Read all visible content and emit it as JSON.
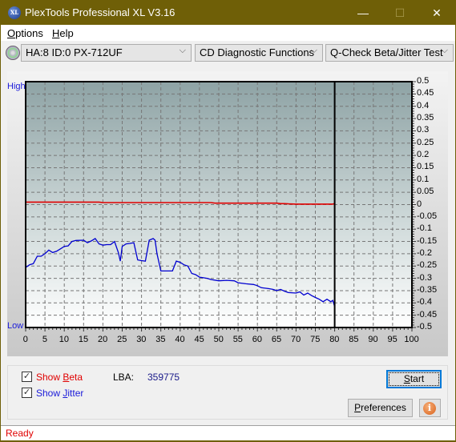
{
  "window": {
    "title": "PlexTools Professional XL V3.16",
    "app_icon": "XL",
    "minimize_icon": "—",
    "maximize_icon": "☐",
    "close_icon": "✕"
  },
  "menu": {
    "items": [
      {
        "label": "Options",
        "accel": "O"
      },
      {
        "label": "Help",
        "accel": "H"
      }
    ]
  },
  "toolbar": {
    "drive_select": "HA:8 ID:0  PX-712UF",
    "function_select": "CD Diagnostic Functions",
    "test_select": "Q-Check Beta/Jitter Test",
    "chevron": "⌵"
  },
  "chart": {
    "high_label": "High",
    "low_label": "Low"
  },
  "chart_data": {
    "type": "line",
    "title": "",
    "xlabel": "",
    "ylabel": "",
    "xlim": [
      0,
      100
    ],
    "ylim": [
      -0.5,
      0.5
    ],
    "x_ticks": [
      0,
      5,
      10,
      15,
      20,
      25,
      30,
      35,
      40,
      45,
      50,
      55,
      60,
      65,
      70,
      75,
      80,
      85,
      90,
      95,
      100
    ],
    "y_ticks": [
      0.5,
      0.45,
      0.4,
      0.35,
      0.3,
      0.25,
      0.2,
      0.15,
      0.1,
      0.05,
      0,
      -0.05,
      -0.1,
      -0.15,
      -0.2,
      -0.25,
      -0.3,
      -0.35,
      -0.4,
      -0.45,
      -0.5
    ],
    "y_tick_labels": [
      "0.5",
      "0.45",
      "0.4",
      "0.35",
      "0.3",
      "0.25",
      "0.2",
      "0.15",
      "0.1",
      "0.05",
      "0",
      "-0.05",
      "-0.1",
      "-0.15",
      "-0.2",
      "-0.25",
      "-0.3",
      "-0.35",
      "-0.4",
      "-0.45",
      "-0.5"
    ],
    "grid": true,
    "end_marker_x": 80,
    "series": [
      {
        "name": "Beta",
        "color": "#e00000",
        "x": [
          0,
          2,
          19,
          20,
          48,
          49,
          65,
          66,
          67,
          68,
          70,
          75,
          79.5,
          80
        ],
        "y": [
          0.01,
          0.01,
          0.01,
          0.008,
          0.008,
          0.006,
          0.006,
          0.004,
          0.004,
          0.003,
          0.002,
          0.002,
          0.002,
          0.004
        ]
      },
      {
        "name": "Jitter",
        "color": "#0000d0",
        "x": [
          0,
          1,
          2,
          3,
          4,
          5,
          6,
          7,
          8,
          9,
          10,
          11,
          12,
          13,
          15,
          16,
          17,
          18,
          19,
          20,
          21,
          22,
          23,
          24,
          24.5,
          25,
          26,
          27,
          28,
          29,
          30,
          31,
          32,
          33,
          33.5,
          34,
          35,
          36,
          37,
          38,
          39,
          40,
          41,
          42,
          43,
          44,
          45,
          47,
          48,
          50,
          52,
          54,
          55,
          57,
          59,
          60,
          61,
          63,
          64,
          65,
          66,
          67,
          68,
          70,
          71,
          72,
          73,
          74,
          75,
          76,
          77,
          78,
          79,
          79.5,
          80
        ],
        "y": [
          -0.256,
          -0.245,
          -0.24,
          -0.21,
          -0.21,
          -0.2,
          -0.185,
          -0.195,
          -0.19,
          -0.18,
          -0.17,
          -0.168,
          -0.15,
          -0.146,
          -0.145,
          -0.155,
          -0.148,
          -0.138,
          -0.16,
          -0.165,
          -0.163,
          -0.163,
          -0.15,
          -0.195,
          -0.23,
          -0.17,
          -0.16,
          -0.158,
          -0.155,
          -0.225,
          -0.228,
          -0.23,
          -0.145,
          -0.138,
          -0.145,
          -0.2,
          -0.27,
          -0.27,
          -0.27,
          -0.27,
          -0.23,
          -0.235,
          -0.245,
          -0.25,
          -0.28,
          -0.285,
          -0.295,
          -0.3,
          -0.305,
          -0.31,
          -0.308,
          -0.31,
          -0.318,
          -0.322,
          -0.325,
          -0.33,
          -0.338,
          -0.342,
          -0.345,
          -0.35,
          -0.345,
          -0.352,
          -0.358,
          -0.36,
          -0.355,
          -0.368,
          -0.36,
          -0.37,
          -0.378,
          -0.385,
          -0.395,
          -0.385,
          -0.395,
          -0.39,
          -0.415
        ]
      }
    ]
  },
  "controls": {
    "show_beta_label": "Show Beta",
    "show_beta_checked": true,
    "show_beta_color": "#e00000",
    "show_jitter_label": "Show Jitter",
    "show_jitter_checked": true,
    "show_jitter_color": "#1a1ad9",
    "lba_label": "LBA:",
    "lba_value": "359775",
    "start_label": "Start",
    "preferences_label": "Preferences",
    "info_icon": "i",
    "check_mark": "✓"
  },
  "status": {
    "text": "Ready"
  }
}
